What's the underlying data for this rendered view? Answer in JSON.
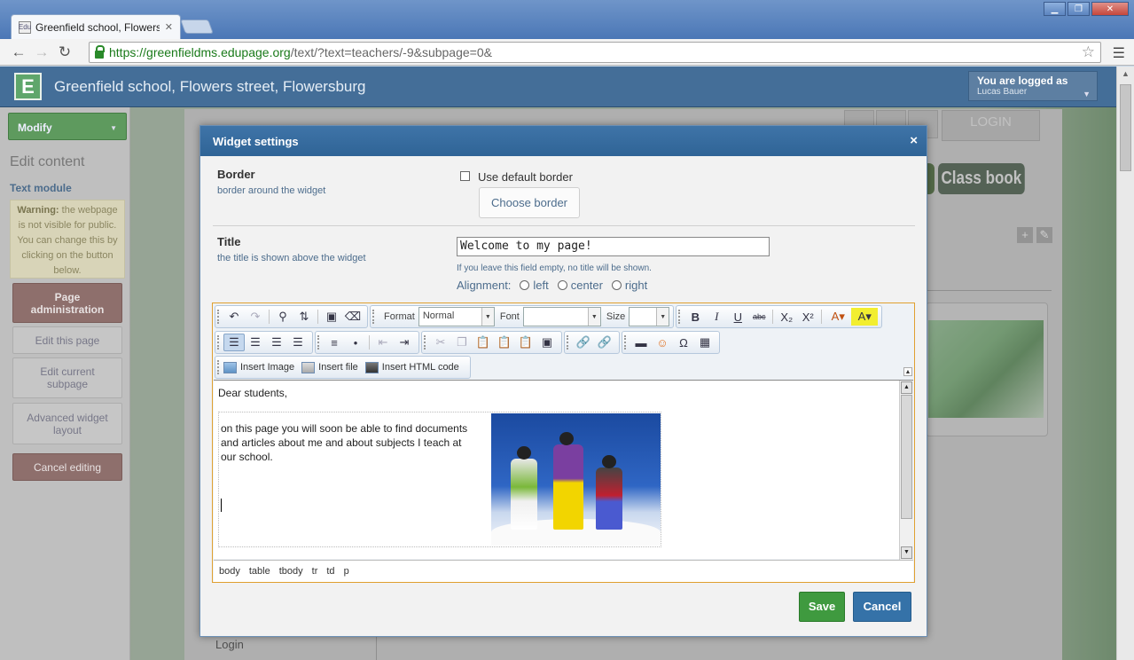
{
  "browser": {
    "tab_title": "Greenfield school, Flowers st",
    "tab_favicon": "Edu",
    "tab_close": "✕",
    "url_scheme": "https://",
    "url_host": "greenfieldms.edupage.org",
    "url_path": "/text/?text=teachers/-9&subpage=0&",
    "win_buttons": [
      "▁",
      "❐",
      "✕"
    ],
    "nav_icons": [
      "back-arrow-icon",
      "forward-arrow-icon",
      "reload-icon"
    ]
  },
  "site": {
    "logo_letter": "E",
    "title": "Greenfield school, Flowers street, Flowersburg",
    "logged_label": "You are logged as",
    "user_name": "Lucas Bauer",
    "login_button": "LOGIN",
    "class_book": "Class book",
    "login_link": "Login"
  },
  "sidebar": {
    "modify": "Modify",
    "edit_content": "Edit content",
    "text_module": "Text module",
    "warning_bold": "Warning:",
    "warning_text": "the webpage is not visible for public. You can change this by clicking on the button below.",
    "buttons": [
      "Page administration",
      "Edit this page",
      "Edit current subpage",
      "Advanced widget layout",
      "Cancel editing"
    ]
  },
  "modal": {
    "title": "Widget settings",
    "close": "×",
    "border": {
      "title": "Border",
      "subtitle": "border around the widget",
      "checkbox_label": "Use default border",
      "choose_button": "Choose border"
    },
    "title_section": {
      "title": "Title",
      "subtitle": "the title is shown above the widget",
      "value": "Welcome to my page!",
      "hint": "If you leave this field empty, no title will be shown.",
      "alignment_label": "Alignment:",
      "alignment_options": [
        "left",
        "center",
        "right"
      ]
    },
    "toolbar": {
      "format_label": "Format",
      "format_value": "Normal",
      "font_label": "Font",
      "font_value": "",
      "size_label": "Size",
      "size_value": "",
      "insert_image": "Insert Image",
      "insert_file": "Insert file",
      "insert_html": "Insert HTML code"
    },
    "content": {
      "greeting": "Dear students,",
      "body": "on this page you will soon be able to find documents and articles about me and about subjects I teach at our school."
    },
    "path": [
      "body",
      "table",
      "tbody",
      "tr",
      "td",
      "p"
    ],
    "save": "Save",
    "cancel": "Cancel"
  }
}
